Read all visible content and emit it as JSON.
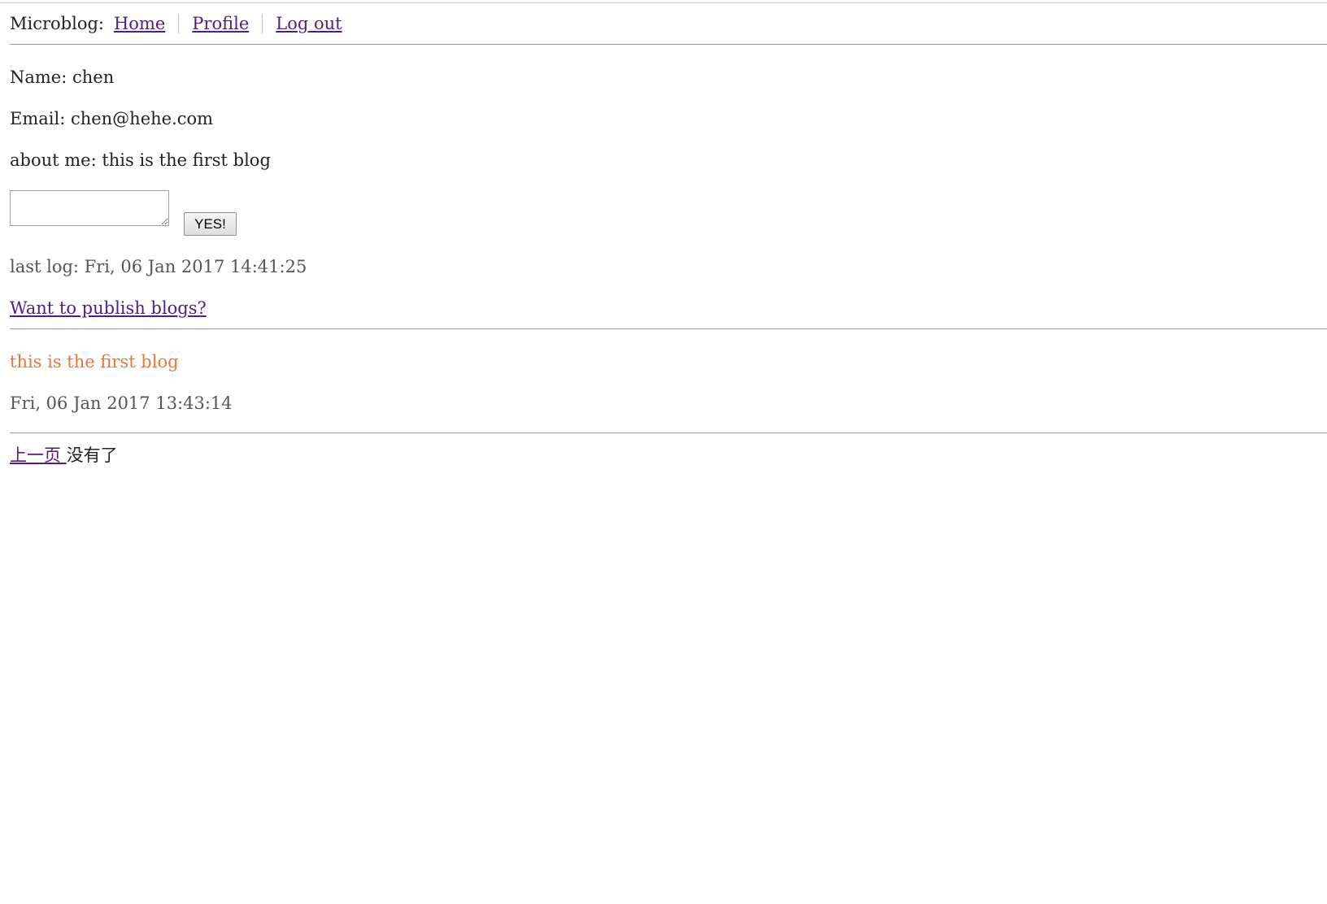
{
  "nav": {
    "brand": "Microblog:",
    "home": "Home",
    "profile": "Profile",
    "logout": "Log out"
  },
  "profile": {
    "name": "Name: chen",
    "email": "Email: chen@hehe.com",
    "about": "about me: this is the first blog"
  },
  "form": {
    "textarea_value": "",
    "submit_label": "YES!"
  },
  "last_log": "last log: Fri, 06 Jan 2017 14:41:25",
  "publish_link": "Want to publish blogs?",
  "posts": [
    {
      "body": "this is the first blog",
      "timestamp": "Fri, 06 Jan 2017 13:43:14"
    }
  ],
  "pagination": {
    "prev": "上一页 ",
    "none": "没有了"
  },
  "colors": {
    "link": "#551a8b",
    "post_text": "#e8783a",
    "muted": "#555555"
  }
}
